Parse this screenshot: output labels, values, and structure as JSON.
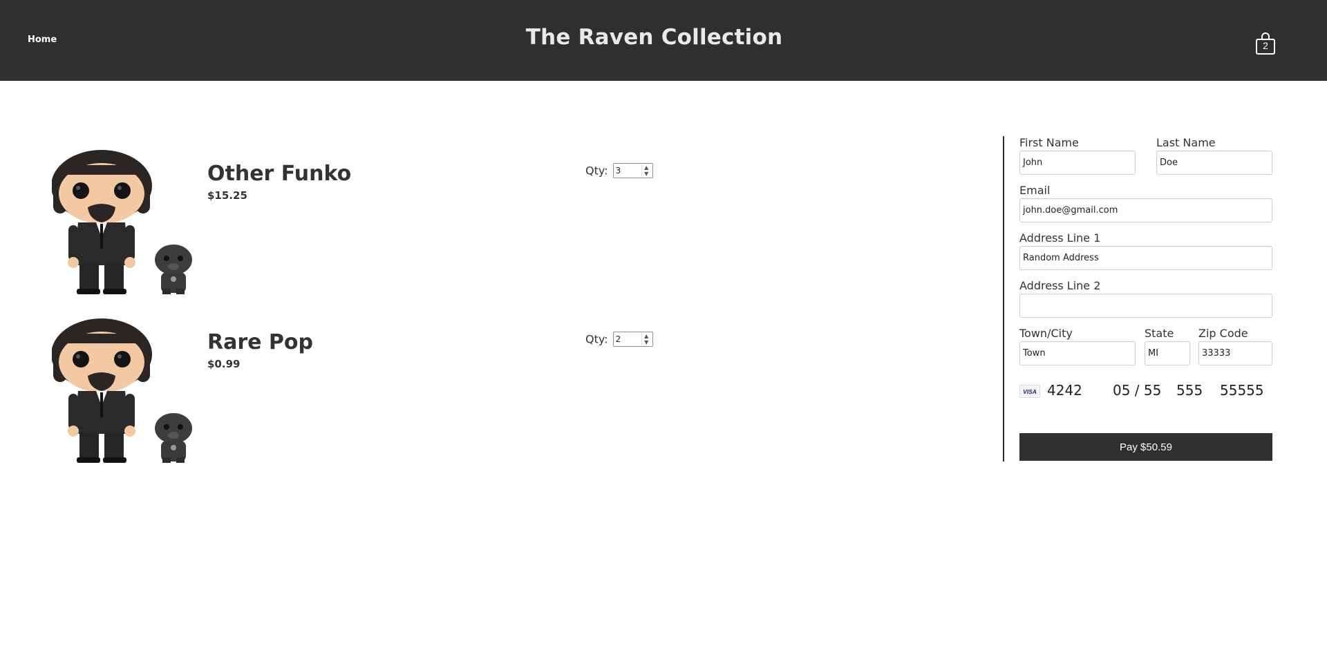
{
  "header": {
    "nav_home": "Home",
    "title": "The Raven Collection",
    "cart_count": "2",
    "cart_icon": "shopping-bag-icon"
  },
  "cart": {
    "items": [
      {
        "name": "Other Funko",
        "price": "$15.25",
        "qty_label": "Qty:",
        "qty": "3",
        "image": "funko-figure-image"
      },
      {
        "name": "Rare Pop",
        "price": "$0.99",
        "qty_label": "Qty:",
        "qty": "2",
        "image": "funko-figure-image"
      }
    ]
  },
  "checkout": {
    "first_name": {
      "label": "First Name",
      "value": "John"
    },
    "last_name": {
      "label": "Last Name",
      "value": "Doe"
    },
    "email": {
      "label": "Email",
      "value": "john.doe@gmail.com"
    },
    "address1": {
      "label": "Address Line 1",
      "value": "Random Address"
    },
    "address2": {
      "label": "Address Line 2",
      "value": ""
    },
    "town": {
      "label": "Town/City",
      "value": "Town"
    },
    "state": {
      "label": "State",
      "value": "MI"
    },
    "zip": {
      "label": "Zip Code",
      "value": "33333"
    },
    "card": {
      "brand": "VISA",
      "number": "4242",
      "exp": "05 / 55",
      "cvc": "555",
      "zip": "55555"
    },
    "pay_button": "Pay $50.59"
  },
  "colors": {
    "header_bg": "#2f2f2f",
    "title_text": "#e9e9e9",
    "button_bg": "#2f2f2f",
    "visa_blue": "#1a1f71"
  }
}
